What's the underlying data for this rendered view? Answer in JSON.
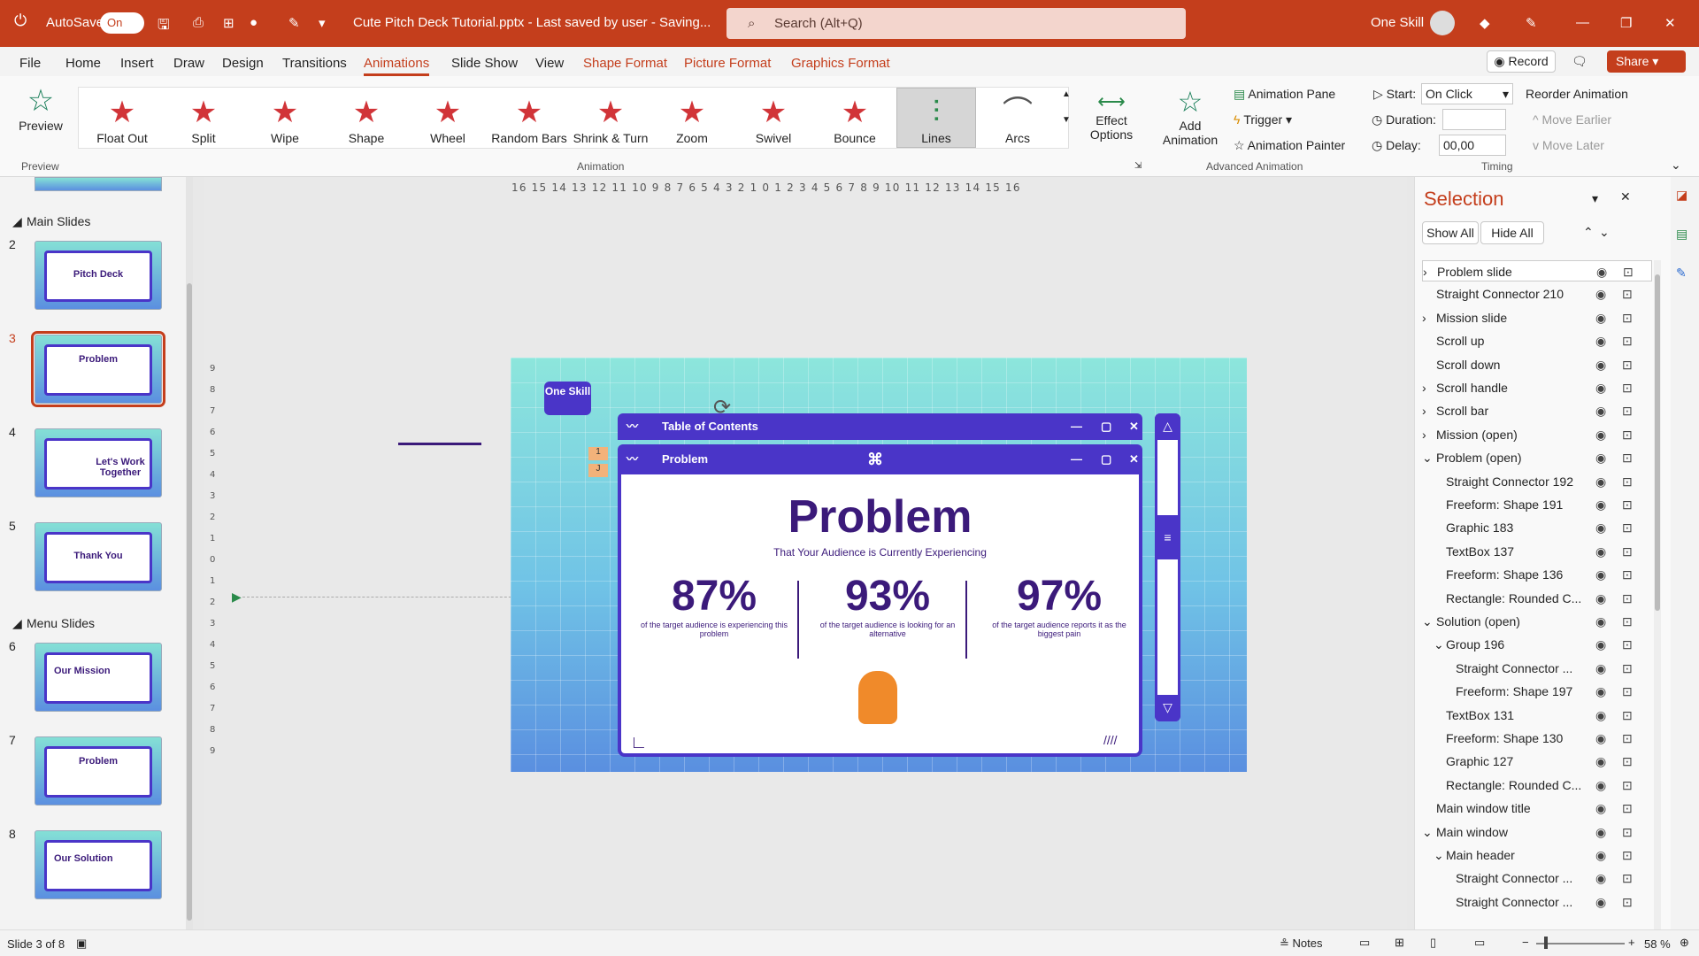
{
  "titlebar": {
    "autosave_label": "AutoSave",
    "autosave_state": "On",
    "doc_title": "Cute Pitch Deck Tutorial.pptx  -  Last saved by user  -  Saving...",
    "search_placeholder": "Search (Alt+Q)",
    "user_name": "One Skill"
  },
  "menu": {
    "file": "File",
    "home": "Home",
    "insert": "Insert",
    "draw": "Draw",
    "design": "Design",
    "transitions": "Transitions",
    "animations": "Animations",
    "slideshow": "Slide Show",
    "view": "View",
    "shape_format": "Shape Format",
    "picture_format": "Picture Format",
    "graphics_format": "Graphics Format",
    "record": "Record",
    "share": "Share"
  },
  "ribbon": {
    "preview": "Preview",
    "preview_group": "Preview",
    "animations": [
      "Float Out",
      "Split",
      "Wipe",
      "Shape",
      "Wheel",
      "Random Bars",
      "Shrink & Turn",
      "Zoom",
      "Swivel",
      "Bounce",
      "Lines",
      "Arcs"
    ],
    "effect_options": "Effect Options",
    "animation_group": "Animation",
    "add_animation": "Add Animation",
    "animation_pane": "Animation Pane",
    "trigger": "Trigger",
    "animation_painter": "Animation Painter",
    "advanced_group": "Advanced Animation",
    "start_label": "Start:",
    "start_value": "On Click",
    "duration_label": "Duration:",
    "delay_label": "Delay:",
    "delay_value": "00,00",
    "timing_group": "Timing",
    "reorder": "Reorder Animation",
    "move_earlier": "Move Earlier",
    "move_later": "Move Later"
  },
  "slides": {
    "main_section": "Main Slides",
    "menu_section": "Menu Slides",
    "items": [
      {
        "num": "2",
        "title": "Pitch Deck"
      },
      {
        "num": "3",
        "title": "Problem"
      },
      {
        "num": "4",
        "title": "Let's Work Together"
      },
      {
        "num": "5",
        "title": "Thank You"
      },
      {
        "num": "6",
        "title": "Our Mission"
      },
      {
        "num": "7",
        "title": "Problem"
      },
      {
        "num": "8",
        "title": "Our Solution"
      }
    ]
  },
  "ruler": {
    "h": "16 15 14 13 12 11 10 9 8 7 6 5 4 3 2 1 0 1 2 3 4 5 6 7 8 9 10 11 12 13 14 15 16",
    "v": "9 8 7 6 5 4 3 2 1 0 1 2 3 4 5 6 7 8 9"
  },
  "slide": {
    "logo": "One Skill",
    "toc_title": "Table of Contents",
    "window_title": "Problem",
    "heading": "Problem",
    "subtitle": "That Your Audience is Currently Experiencing",
    "order1": "1",
    "order2": "J",
    "stats": [
      {
        "value": "87%",
        "desc": "of the target audience is experiencing this problem"
      },
      {
        "value": "93%",
        "desc": "of the target audience is looking for an alternative"
      },
      {
        "value": "97%",
        "desc": "of the target audience reports it as the biggest pain"
      }
    ]
  },
  "selection": {
    "title": "Selection",
    "show_all": "Show All",
    "hide_all": "Hide All",
    "items": [
      {
        "label": "Problem slide",
        "indent": 0,
        "arrow": ">"
      },
      {
        "label": "Straight Connector 210",
        "indent": 0,
        "arrow": ""
      },
      {
        "label": "Mission slide",
        "indent": 0,
        "arrow": ">"
      },
      {
        "label": "Scroll up",
        "indent": 0,
        "arrow": ""
      },
      {
        "label": "Scroll down",
        "indent": 0,
        "arrow": ""
      },
      {
        "label": "Scroll handle",
        "indent": 0,
        "arrow": ">"
      },
      {
        "label": "Scroll bar",
        "indent": 0,
        "arrow": ">"
      },
      {
        "label": "Mission (open)",
        "indent": 0,
        "arrow": ">"
      },
      {
        "label": "Problem (open)",
        "indent": 0,
        "arrow": "v"
      },
      {
        "label": "Straight Connector 192",
        "indent": 1,
        "arrow": ""
      },
      {
        "label": "Freeform: Shape 191",
        "indent": 1,
        "arrow": ""
      },
      {
        "label": "Graphic 183",
        "indent": 1,
        "arrow": ""
      },
      {
        "label": "TextBox 137",
        "indent": 1,
        "arrow": ""
      },
      {
        "label": "Freeform: Shape 136",
        "indent": 1,
        "arrow": ""
      },
      {
        "label": "Rectangle: Rounded C...",
        "indent": 1,
        "arrow": ""
      },
      {
        "label": "Solution (open)",
        "indent": 0,
        "arrow": "v"
      },
      {
        "label": "Group 196",
        "indent": 1,
        "arrow": "v"
      },
      {
        "label": "Straight Connector ...",
        "indent": 2,
        "arrow": ""
      },
      {
        "label": "Freeform: Shape 197",
        "indent": 2,
        "arrow": ""
      },
      {
        "label": "TextBox 131",
        "indent": 1,
        "arrow": ""
      },
      {
        "label": "Freeform: Shape 130",
        "indent": 1,
        "arrow": ""
      },
      {
        "label": "Graphic 127",
        "indent": 1,
        "arrow": ""
      },
      {
        "label": "Rectangle: Rounded C...",
        "indent": 1,
        "arrow": ""
      },
      {
        "label": "Main window title",
        "indent": 0,
        "arrow": ""
      },
      {
        "label": "Main window",
        "indent": 0,
        "arrow": "v"
      },
      {
        "label": "Main header",
        "indent": 1,
        "arrow": "v"
      },
      {
        "label": "Straight Connector ...",
        "indent": 2,
        "arrow": ""
      },
      {
        "label": "Straight Connector ...",
        "indent": 2,
        "arrow": ""
      }
    ]
  },
  "status": {
    "slide_info": "Slide 3 of 8",
    "notes": "Notes",
    "zoom": "58 %"
  },
  "colors": {
    "accent": "#c43e1c",
    "brand_purple": "#4a35c8",
    "heading": "#3b1a7a"
  }
}
